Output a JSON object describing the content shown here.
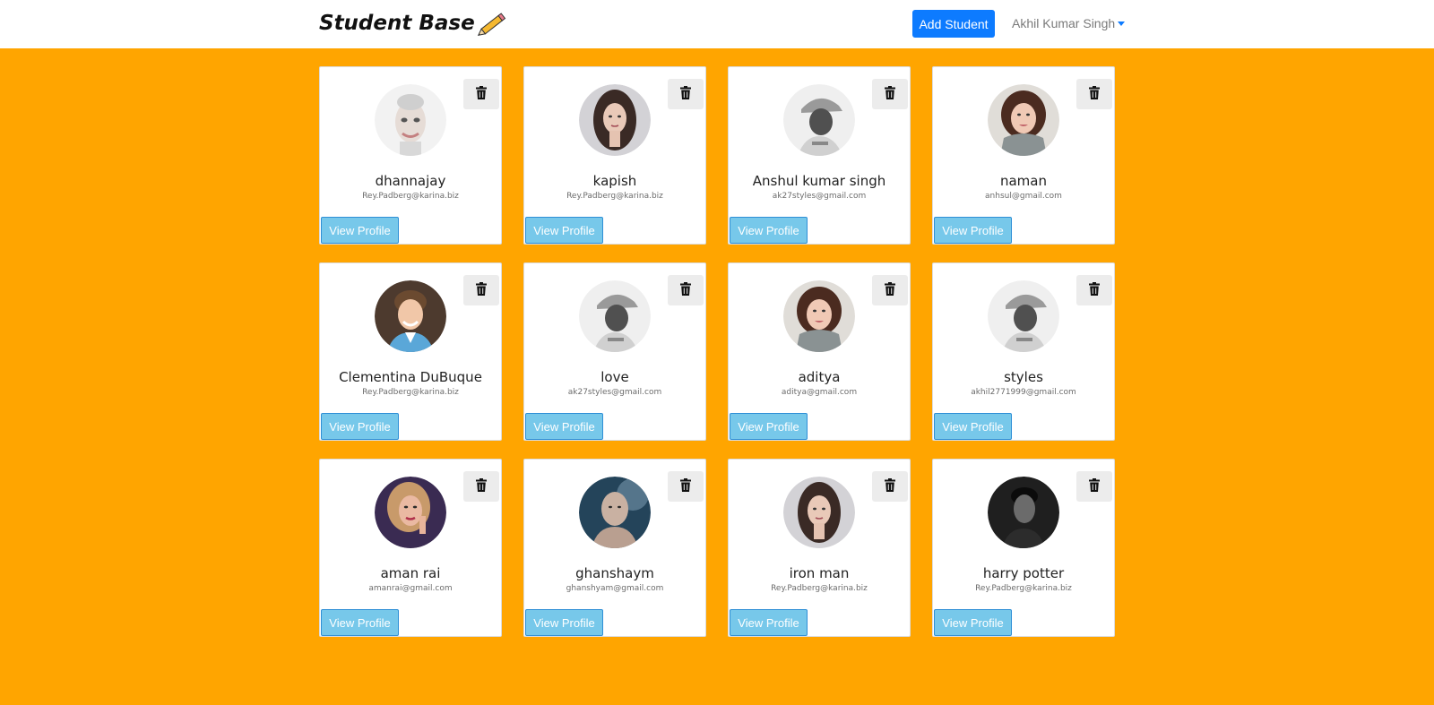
{
  "navbar": {
    "brand": "Student Base",
    "brand_icon": "pencil-icon",
    "add_student_label": "Add Student",
    "user_name": "Akhil Kumar Singh"
  },
  "colors": {
    "page_background": "#ffa500",
    "primary_button": "#0d7bff",
    "view_profile_button": "#77c8ea"
  },
  "students": [
    {
      "name": "dhannajay",
      "email": "Rey.Padberg@karina.biz",
      "view_label": "View Profile",
      "avatar": "light"
    },
    {
      "name": "kapish",
      "email": "Rey.Padberg@karina.biz",
      "view_label": "View Profile",
      "avatar": "woman-dark-hair"
    },
    {
      "name": "Anshul kumar singh",
      "email": "ak27styles@gmail.com",
      "view_label": "View Profile",
      "avatar": "cap-gray"
    },
    {
      "name": "naman",
      "email": "anhsul@gmail.com",
      "view_label": "View Profile",
      "avatar": "woman-scarf"
    },
    {
      "name": "Clementina DuBuque",
      "email": "Rey.Padberg@karina.biz",
      "view_label": "View Profile",
      "avatar": "man-headset"
    },
    {
      "name": "love",
      "email": "ak27styles@gmail.com",
      "view_label": "View Profile",
      "avatar": "cap-gray"
    },
    {
      "name": "aditya",
      "email": "aditya@gmail.com",
      "view_label": "View Profile",
      "avatar": "woman-scarf"
    },
    {
      "name": "styles",
      "email": "akhil2771999@gmail.com",
      "view_label": "View Profile",
      "avatar": "cap-gray"
    },
    {
      "name": "aman rai",
      "email": "amanrai@gmail.com",
      "view_label": "View Profile",
      "avatar": "woman-blonde"
    },
    {
      "name": "ghanshaym",
      "email": "ghanshyam@gmail.com",
      "view_label": "View Profile",
      "avatar": "man-smoke"
    },
    {
      "name": "iron man",
      "email": "Rey.Padberg@karina.biz",
      "view_label": "View Profile",
      "avatar": "woman-dark-hair"
    },
    {
      "name": "harry potter",
      "email": "Rey.Padberg@karina.biz",
      "view_label": "View Profile",
      "avatar": "man-dark"
    }
  ]
}
